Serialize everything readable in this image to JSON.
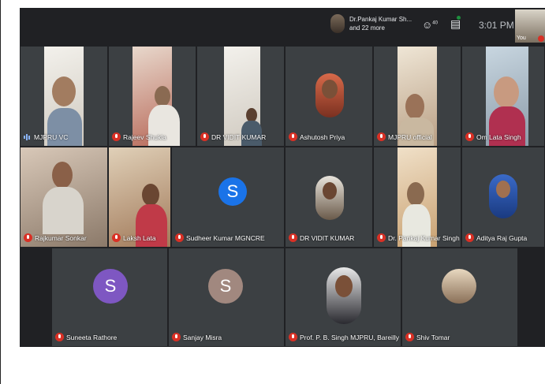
{
  "topbar": {
    "presenter_name": "Dr.Pankaj Kumar Sh...",
    "presenter_more": "and 22 more",
    "people_count": "40",
    "clock": "3:01 PM",
    "self_label": "You"
  },
  "participants": {
    "mjpru_vc": "MJPRU VC",
    "rajeev_shukla": "Rajeev Shukla",
    "vidit_1": "DR VIDIT KUMAR",
    "ashutosh": "Ashutosh Priya",
    "mjpru_official": "MJPRU official",
    "om_lata": "Om Lata Singh",
    "rajkumar": "Rajkumar Sonkar",
    "laksh_lata": "Laksh Lata",
    "sudheer": "Sudheer Kumar MGNCRE",
    "vidit_2": "DR VIDIT KUMAR",
    "pankaj": "Dr. Pankaj Kumar Singh",
    "aditya": "Aditya Raj Gupta",
    "suneeta": "Suneeta Rathore",
    "sanjay": "Sanjay Misra",
    "pbsingh": "Prof. P. B. Singh MJPRU, Bareilly",
    "shiv": "Shiv Tomar"
  },
  "avatars": {
    "sudheer_letter": "S",
    "suneeta_letter": "S",
    "sanjay_letter": "S"
  },
  "colors": {
    "meet_bg": "#202124",
    "tile_bg": "#3c4043",
    "mic_off": "#d93025",
    "sudheer_avatar": "#1a73e8",
    "suneeta_avatar": "#7e57c2",
    "sanjay_avatar": "#a1887f"
  }
}
